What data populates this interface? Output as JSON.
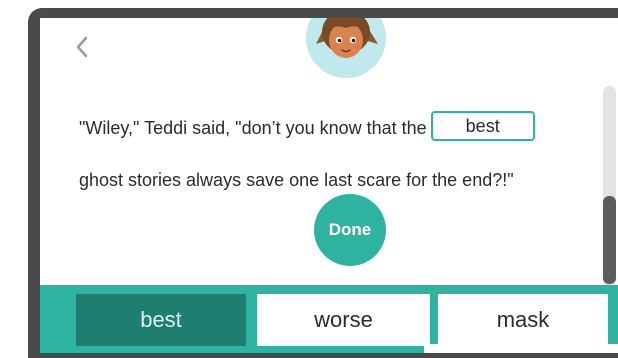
{
  "screen": {
    "back_icon": "chevron-left-icon",
    "avatar_icon": "teddi-avatar-icon"
  },
  "sentence": {
    "part1": "\"Wiley,\" Teddi said, \"don’t you know that the",
    "blank_value": "best",
    "part2": "ghost stories always save one last scare for the end?!\""
  },
  "done_label": "Done",
  "choices": [
    {
      "label": "best",
      "selected": true
    },
    {
      "label": "worse",
      "selected": false
    },
    {
      "label": "mask",
      "selected": false
    }
  ],
  "colors": {
    "accent": "#2fb3a1",
    "selected_choice": "#1e7f70",
    "device_frame": "#4a4a4c"
  }
}
